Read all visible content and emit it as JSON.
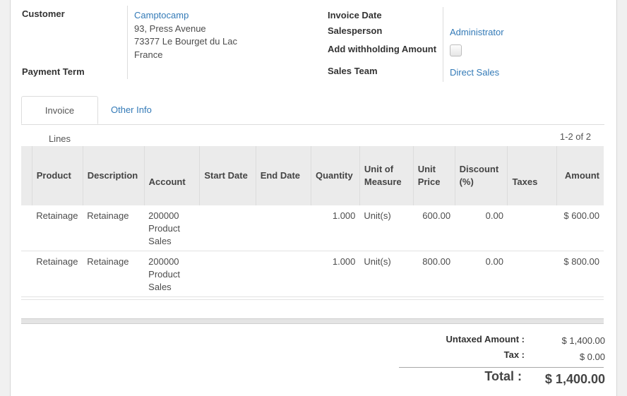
{
  "customer": {
    "label": "Customer",
    "name": "Camptocamp",
    "address_line1": "93, Press Avenue",
    "address_line2": "73377 Le Bourget du Lac",
    "country": "France"
  },
  "payment_term": {
    "label": "Payment Term"
  },
  "invoice_date": {
    "label": "Invoice Date"
  },
  "salesperson": {
    "label": "Salesperson",
    "value": "Administrator"
  },
  "withholding": {
    "label": "Add withholding Amount",
    "checked": false
  },
  "sales_team": {
    "label": "Sales Team",
    "value": "Direct Sales"
  },
  "tabs": [
    {
      "label": "Invoice Lines",
      "active": true
    },
    {
      "label": "Other Info",
      "active": false
    }
  ],
  "pager": "1-2 of 2",
  "columns": {
    "product": "Product",
    "description": "Description",
    "account": "Account",
    "start_date": "Start Date",
    "end_date": "End Date",
    "quantity": "Quantity",
    "uom": "Unit of Measure",
    "unit_price": "Unit Price",
    "discount": "Discount (%)",
    "taxes": "Taxes",
    "amount": "Amount"
  },
  "rows": [
    {
      "product": "Retainage",
      "description": "Retainage",
      "account": "200000 Product Sales",
      "start_date": "",
      "end_date": "",
      "quantity": "1.000",
      "uom": "Unit(s)",
      "unit_price": "600.00",
      "discount": "0.00",
      "taxes": "",
      "amount": "$ 600.00"
    },
    {
      "product": "Retainage",
      "description": "Retainage",
      "account": "200000 Product Sales",
      "start_date": "",
      "end_date": "",
      "quantity": "1.000",
      "uom": "Unit(s)",
      "unit_price": "800.00",
      "discount": "0.00",
      "taxes": "",
      "amount": "$ 800.00"
    }
  ],
  "totals": {
    "untaxed_label": "Untaxed Amount :",
    "untaxed_value": "$ 1,400.00",
    "tax_label": "Tax :",
    "tax_value": "$ 0.00",
    "total_label": "Total :",
    "total_value": "$ 1,400.00"
  },
  "colors": {
    "link": "#337ab7",
    "header_bg": "#ebebeb"
  }
}
